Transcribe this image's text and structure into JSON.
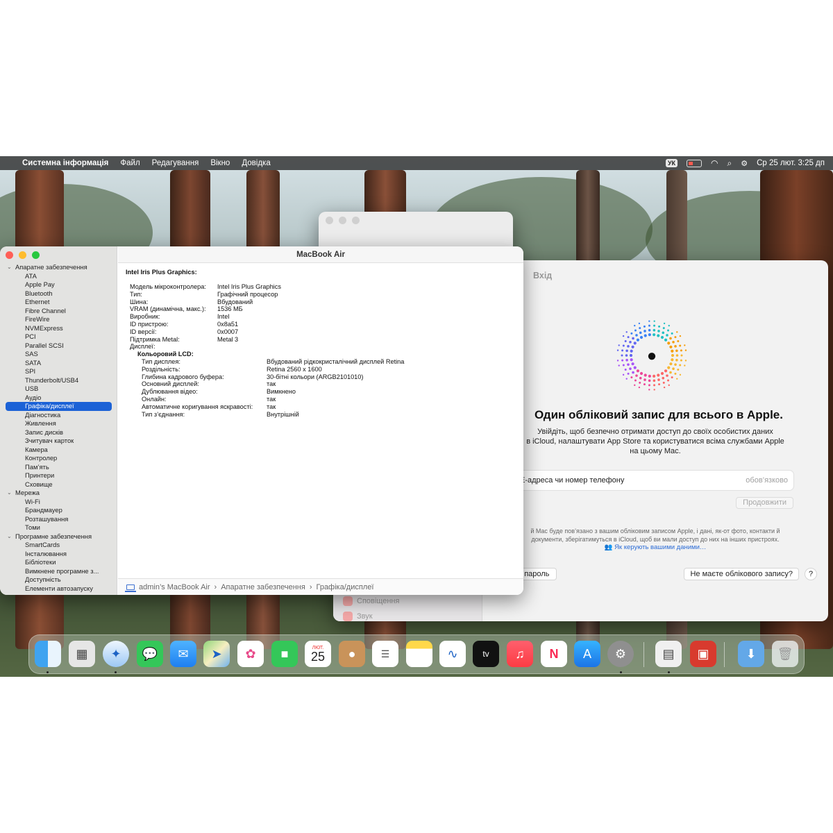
{
  "menubar": {
    "app_name": "Системна інформація",
    "menus": [
      "Файл",
      "Редагування",
      "Вікно",
      "Довідка"
    ],
    "input_source": "УК",
    "datetime": "Ср 25 лют.  3:25 дп"
  },
  "sysinfo": {
    "window_title": "MacBook Air",
    "sidebar": {
      "hardware_group": "Апаратне забезпечення",
      "hardware_items": [
        "ATA",
        "Apple Pay",
        "Bluetooth",
        "Ethernet",
        "Fibre Channel",
        "FireWire",
        "NVMExpress",
        "PCI",
        "Parallel SCSI",
        "SAS",
        "SATA",
        "SPI",
        "Thunderbolt/USB4",
        "USB",
        "Аудіо"
      ],
      "selected_item": "Графіка/дисплеї",
      "hardware_items_after": [
        "Діагностика",
        "Живлення",
        "Запис дисків",
        "Зчитувач карток",
        "Камера",
        "Контролер",
        "Пам’ять",
        "Принтери",
        "Сховище"
      ],
      "network_group": "Мережа",
      "network_items": [
        "Wi-Fi",
        "Брандмауер",
        "Розташування",
        "Томи"
      ],
      "software_group": "Програмне забезпечення",
      "software_items": [
        "SmartCards",
        "Інсталювання",
        "Бібліотеки",
        "Вимкнене програмне з...",
        "Доступність",
        "Елементи автозапуску"
      ]
    },
    "content": {
      "heading": "Intel Iris Plus Graphics:",
      "rows": [
        {
          "k": "Модель мікроконтролера:",
          "v": "Intel Iris Plus Graphics"
        },
        {
          "k": "Тип:",
          "v": "Графічний процесор"
        },
        {
          "k": "Шина:",
          "v": "Вбудований"
        },
        {
          "k": "VRAM (динамічна, макс.):",
          "v": "1536 МБ"
        },
        {
          "k": "Виробник:",
          "v": "Intel"
        },
        {
          "k": "ID пристрою:",
          "v": "0x8a51"
        },
        {
          "k": "ID версії:",
          "v": "0x0007"
        },
        {
          "k": "Підтримка Metal:",
          "v": "Metal 3"
        },
        {
          "k": "Дисплеї:",
          "v": ""
        }
      ],
      "display_name": "Кольоровий LCD:",
      "display_rows": [
        {
          "k": "Тип дисплея:",
          "v": "Вбудований рідкокристалічний дисплей Retina"
        },
        {
          "k": "Роздільність:",
          "v": "Retina 2560 x 1600"
        },
        {
          "k": "Глибина кадрового буфера:",
          "v": "30-бітні кольори (ARGB2101010)"
        },
        {
          "k": "Основний дисплей:",
          "v": "так"
        },
        {
          "k": "Дублювання відео:",
          "v": "Вимкнено"
        },
        {
          "k": "Онлайн:",
          "v": "так"
        },
        {
          "k": "Автоматичне коригування яскравості:",
          "v": "так"
        },
        {
          "k": "Тип з’єднання:",
          "v": "Внутрішній"
        }
      ]
    },
    "path": [
      "admin’s MacBook Air",
      "Апаратне забезпечення",
      "Графіка/дисплеї"
    ]
  },
  "settings": {
    "pane_title": "Вхід",
    "sidebar_items": [
      "Сповіщення",
      "Звук"
    ],
    "headline": "Один обліковий запис для всього в Apple.",
    "subtitle_line1": "Увійдіть, щоб безпечно отримати доступ до своїх особистих даних",
    "subtitle_line2": "в iCloud, налаштувати App Store та користуватися всіма службами Apple",
    "subtitle_line3": "на цьому Mac.",
    "email_placeholder": "E-адреса чи номер телефону",
    "required_label": "обов’язково",
    "continue_label": "Продовжити",
    "privacy_line1": "й Mac буде пов’язано з вашим обліковим записом Apple, і дані, як-от фото, контакти й",
    "privacy_line2": "документи, зберігатимуться в iCloud, щоб ви мали доступ до них на інших пристроях.",
    "privacy_link": "Як керують вашими даними…",
    "forgot_label": "и пароль",
    "no_account_label": "Не маєте облікового запису?",
    "help_label": "?"
  },
  "dock": {
    "calendar_month": "ЛЮТ.",
    "calendar_day": "25",
    "apps": [
      "finder",
      "launchpad",
      "safari",
      "messages",
      "mail",
      "maps",
      "photos",
      "facetime",
      "calendar",
      "contacts",
      "reminders",
      "notes",
      "freeform",
      "tv",
      "music",
      "news",
      "app-store",
      "system-settings",
      "system-information",
      "photo-booth",
      "downloads",
      "trash"
    ]
  },
  "colors": {
    "selection_blue": "#1c62d6",
    "link_blue": "#2a6bd6",
    "close_red": "#ff5f57",
    "minimize_yellow": "#febc2e",
    "zoom_green": "#28c840"
  }
}
